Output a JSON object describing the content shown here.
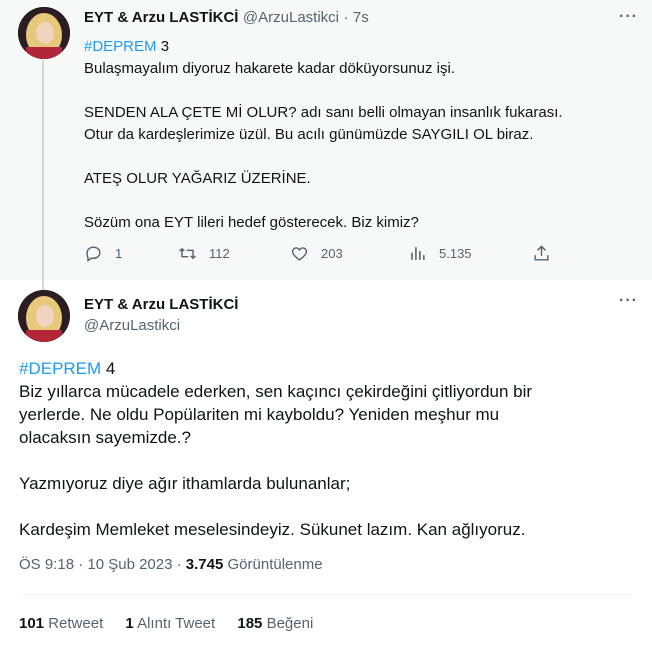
{
  "tweet1": {
    "author_name": "EYT & Arzu LASTİKCİ",
    "handle": "@ArzuLastikci",
    "separator": "·",
    "time": "7s",
    "hashtag": "#DEPREM",
    "thread_number": "3",
    "lines": [
      "Bulaşmayalım diyoruz hakarete kadar döküyorsunuz işi.",
      "SENDEN ALA ÇETE Mİ OLUR? adı sanı belli olmayan insanlık fukarası.",
      "Otur da kardeşlerimize üzül. Bu acılı günümüzde SAYGILI OL biraz.",
      "ATEŞ OLUR YAĞARIZ ÜZERİNE.",
      "Sözüm ona EYT lileri hedef gösterecek. Biz kimiz?"
    ],
    "actions": {
      "reply_count": "1",
      "retweet_count": "112",
      "like_count": "203",
      "view_count": "5.135"
    }
  },
  "tweet2": {
    "author_name": "EYT & Arzu LASTİKCİ",
    "handle": "@ArzuLastikci",
    "hashtag": "#DEPREM",
    "thread_number": "4",
    "lines": [
      "Biz yıllarca mücadele ederken, sen kaçıncı çekirdeğini çitliyordun bir",
      "yerlerde. Ne oldu Popülariten mi kayboldu? Yeniden meşhur mu",
      "olacaksın sayemizde.?",
      "Yazmıyoruz diye ağır ithamlarda bulunanlar;",
      "Kardeşim Memleket meselesindeyiz. Sükunet lazım. Kan ağlıyoruz."
    ],
    "timestamp": "ÖS 9:18 · 10 Şub 2023 ·",
    "views_count": "3.745",
    "views_label": "Görüntülenme",
    "stats": {
      "retweet_count": "101",
      "retweet_label": "Retweet",
      "quote_count": "1",
      "quote_label": "Alıntı Tweet",
      "like_count": "185",
      "like_label": "Beğeni"
    }
  },
  "more_glyph": "···",
  "colors": {
    "accent": "#1d9bf0",
    "muted": "#536471",
    "text": "#0f1419",
    "highlight_bg": "#f7f9f9"
  },
  "icons": [
    "reply-icon",
    "retweet-icon",
    "like-icon",
    "views-icon",
    "share-icon",
    "more-icon"
  ]
}
